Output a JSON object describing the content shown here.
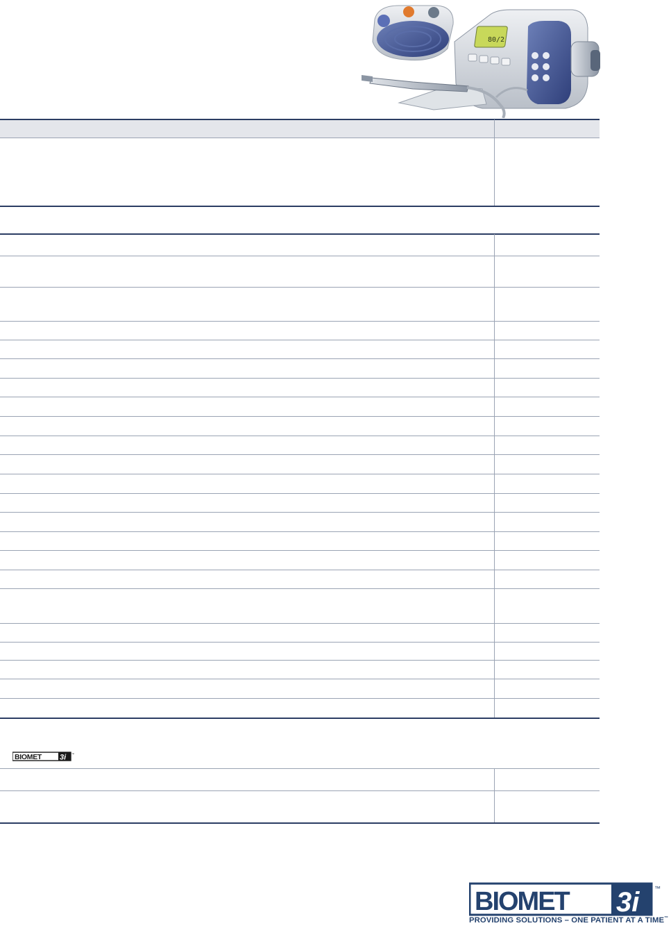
{
  "brand": {
    "logo_text": "BIOMET 3i",
    "tagline": "PROVIDING SOLUTIONS – ONE PATIENT AT A TIME",
    "tagline_mark": "™",
    "logo_mark": "™",
    "colors": {
      "navy": "#24426e",
      "slate": "#6a7ea6",
      "rule": "#9aa3b3"
    }
  },
  "product_image": {
    "icon": "surgical-motor-unit-illustration",
    "display_readout": "80/2"
  },
  "table": {
    "has_header_band": true,
    "section_logo_text": "BIOMET 3i"
  }
}
